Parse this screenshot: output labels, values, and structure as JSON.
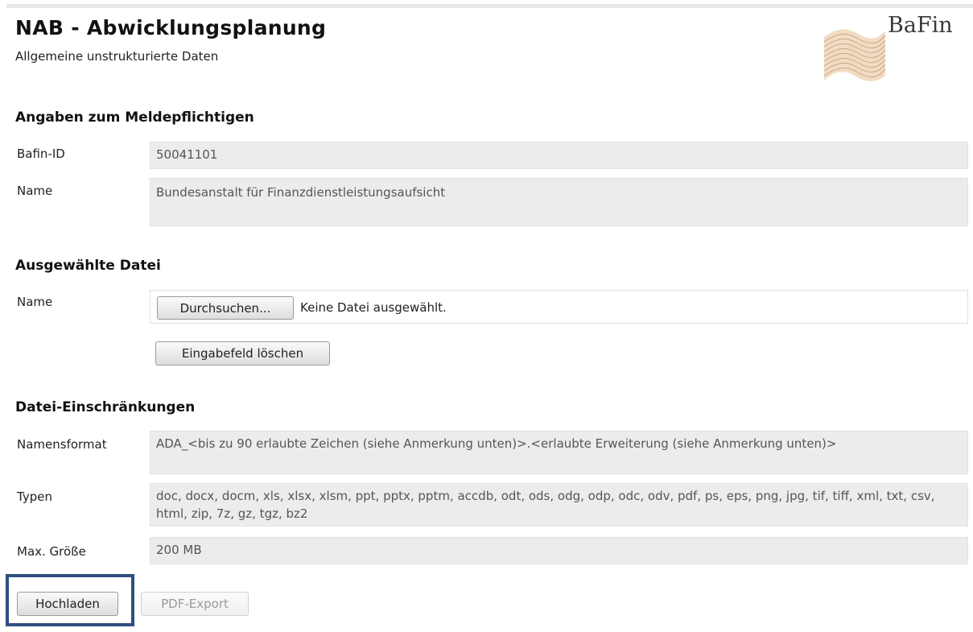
{
  "header": {
    "title": "NAB - Abwicklungsplanung",
    "subtitle": "Allgemeine unstrukturierte Daten",
    "logo_text": "BaFin"
  },
  "reporter": {
    "section_title": "Angaben zum Meldepflichtigen",
    "bafin_id_label": "Bafin-ID",
    "bafin_id_value": "50041101",
    "name_label": "Name",
    "name_value": "Bundesanstalt für Finanzdienstleistungsaufsicht"
  },
  "file": {
    "section_title": "Ausgewählte Datei",
    "name_label": "Name",
    "browse_label": "Durchsuchen...",
    "no_file_text": "Keine Datei ausgewählt.",
    "clear_label": "Eingabefeld löschen"
  },
  "restrictions": {
    "section_title": "Datei-Einschränkungen",
    "name_format_label": "Namensformat",
    "name_format_value": "ADA_<bis zu 90 erlaubte Zeichen (siehe Anmerkung unten)>.<erlaubte Erweiterung (siehe Anmerkung unten)>",
    "types_label": "Typen",
    "types_value": "doc, docx, docm, xls, xlsx, xlsm, ppt, pptx, pptm, accdb, odt, ods, odg, odp, odc, odv, pdf, ps, eps, png, jpg, tif, tiff, xml, txt, csv, html, zip, 7z, gz, tgz, bz2",
    "max_size_label": "Max. Größe",
    "max_size_value": "200 MB"
  },
  "actions": {
    "upload_label": "Hochladen",
    "pdf_export_label": "PDF-Export"
  },
  "colors": {
    "highlight_border": "#2f4f7f",
    "field_background": "#ececec"
  }
}
